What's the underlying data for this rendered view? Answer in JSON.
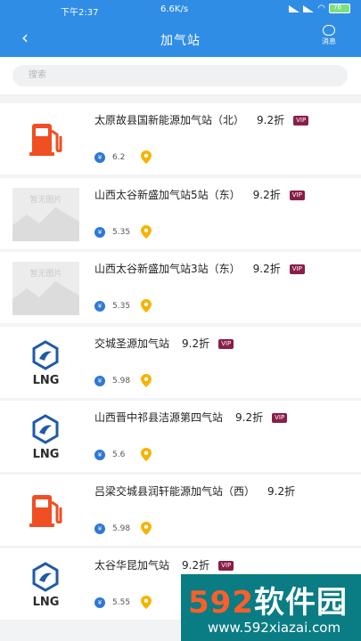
{
  "statusbar": {
    "time": "下午2:37",
    "speed": "6.6K/s",
    "battery": "76"
  },
  "navbar": {
    "title": "加气站",
    "message_label": "消息"
  },
  "search": {
    "placeholder": "搜索"
  },
  "placeholder_text": "暂无图片",
  "stations": [
    {
      "name": "太原故县国新能源加气站（北）",
      "discount": "9.2折",
      "vip": "VIP",
      "price": "6.2",
      "thumb": "gas-pump"
    },
    {
      "name": "山西太谷新盛加气站5站（东）",
      "discount": "9.2折",
      "vip": "VIP",
      "price": "5.35",
      "thumb": "placeholder"
    },
    {
      "name": "山西太谷新盛加气站3站（东）",
      "discount": "9.2折",
      "vip": "VIP",
      "price": "5.35",
      "thumb": "placeholder"
    },
    {
      "name": "交城圣源加气站",
      "discount": "9.2折",
      "vip": "VIP",
      "price": "5.98",
      "thumb": "lng"
    },
    {
      "name": "山西晋中祁县洁源第四气站",
      "discount": "9.2折",
      "vip": "VIP",
      "price": "5.6",
      "thumb": "lng"
    },
    {
      "name": "吕梁交城县润轩能源加气站（西）",
      "discount": "9.2折",
      "vip": "",
      "price": "5.98",
      "thumb": "gas-pump"
    },
    {
      "name": "太谷华昆加气站",
      "discount": "9.2折",
      "vip": "VIP",
      "price": "5.55",
      "thumb": "lng"
    }
  ],
  "currency_symbol": "¥",
  "lng_label": "LNG",
  "watermark": {
    "brand": "592软件园",
    "url": "www.592xiazai.com"
  },
  "colors": {
    "header": "#2f8de6",
    "vip": "#8a1e4a",
    "pin": "#f5b400",
    "pump": "#f04e23",
    "lng": "#1f5aa6"
  }
}
